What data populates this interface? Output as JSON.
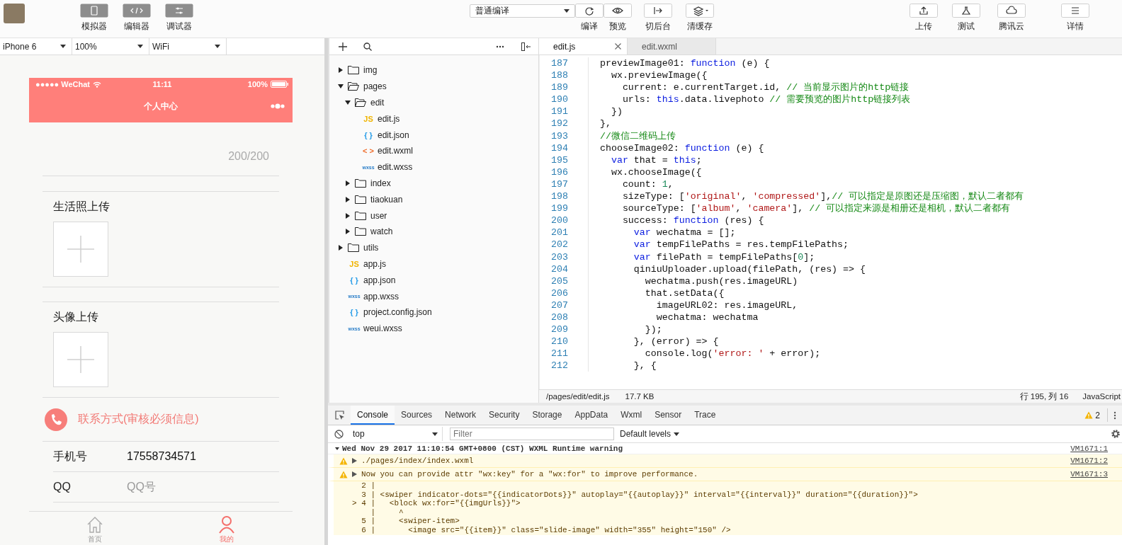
{
  "toolbar": {
    "left_buttons": [
      {
        "label": "模拟器",
        "kind": "phone"
      },
      {
        "label": "编辑器",
        "kind": "code"
      },
      {
        "label": "调试器",
        "kind": "debug"
      }
    ],
    "compile_select": {
      "value": "普通编译"
    },
    "center_buttons": [
      {
        "label": "编译",
        "kind": "refresh"
      },
      {
        "label": "预览",
        "kind": "eye"
      },
      {
        "label": "切后台",
        "kind": "switch"
      },
      {
        "label": "清缓存",
        "kind": "layers"
      }
    ],
    "right_buttons": [
      {
        "label": "上传",
        "kind": "upload"
      },
      {
        "label": "测试",
        "kind": "flask"
      },
      {
        "label": "腾讯云",
        "kind": "cloud"
      },
      {
        "label": "详情",
        "kind": "menu"
      }
    ]
  },
  "simulator": {
    "selects": [
      {
        "value": "iPhone 6"
      },
      {
        "value": "100%"
      },
      {
        "value": "WiFi"
      }
    ],
    "status_bar": {
      "carrier": "●●●●● WeChat",
      "time": "11:11",
      "battery": "100%"
    },
    "nav_title": "个人中心",
    "counter": "200/200",
    "uploads": [
      {
        "title": "生活照上传"
      },
      {
        "title": "头像上传"
      }
    ],
    "contact_heading": "联系方式(审核必须信息)",
    "fields": [
      {
        "label": "手机号",
        "value": "17558734571"
      },
      {
        "label": "QQ",
        "placeholder": "QQ号"
      }
    ],
    "tab_bar": [
      {
        "label": "首页",
        "kind": "home",
        "selected": false
      },
      {
        "label": "我的",
        "kind": "person",
        "selected": true
      }
    ]
  },
  "file_tree": {
    "items": [
      {
        "name": "img",
        "kind": "folder",
        "expanded": false
      },
      {
        "name": "pages",
        "kind": "folder",
        "expanded": true,
        "children": [
          {
            "name": "edit",
            "kind": "folder",
            "expanded": true,
            "children": [
              {
                "name": "edit.js",
                "kind": "js",
                "icon_text": "JS"
              },
              {
                "name": "edit.json",
                "kind": "json",
                "icon_text": "{ }"
              },
              {
                "name": "edit.wxml",
                "kind": "wxml",
                "icon_text": "< >"
              },
              {
                "name": "edit.wxss",
                "kind": "wxss",
                "icon_text": "wxss"
              }
            ]
          },
          {
            "name": "index",
            "kind": "folder",
            "expanded": false
          },
          {
            "name": "tiaokuan",
            "kind": "folder",
            "expanded": false
          },
          {
            "name": "user",
            "kind": "folder",
            "expanded": false
          },
          {
            "name": "watch",
            "kind": "folder",
            "expanded": false
          }
        ]
      },
      {
        "name": "utils",
        "kind": "folder",
        "expanded": false
      },
      {
        "name": "app.js",
        "kind": "js",
        "icon_text": "JS"
      },
      {
        "name": "app.json",
        "kind": "json",
        "icon_text": "{ }"
      },
      {
        "name": "app.wxss",
        "kind": "wxss",
        "icon_text": "wxss"
      },
      {
        "name": "project.config.json",
        "kind": "json",
        "icon_text": "{ }"
      },
      {
        "name": "weui.wxss",
        "kind": "wxss",
        "icon_text": "wxss"
      }
    ]
  },
  "editor": {
    "tabs": [
      {
        "label": "edit.js",
        "selected": true,
        "closable": true
      },
      {
        "label": "edit.wxml",
        "selected": false,
        "closable": false
      }
    ],
    "lines": [
      {
        "number": "187",
        "tokens": [
          {
            "kind": "plain",
            "text": "  previewImage01: "
          },
          {
            "kind": "keyword",
            "text": "function"
          },
          {
            "kind": "plain",
            "text": " (e) {"
          }
        ]
      },
      {
        "number": "188",
        "tokens": [
          {
            "kind": "plain",
            "text": "    wx.previewImage({"
          }
        ]
      },
      {
        "number": "189",
        "tokens": [
          {
            "kind": "plain",
            "text": "      current: e.currentTarget.id, "
          },
          {
            "kind": "comment",
            "text": "// 当前显示图片的http链接"
          }
        ]
      },
      {
        "number": "190",
        "tokens": [
          {
            "kind": "plain",
            "text": "      urls: "
          },
          {
            "kind": "keyword",
            "text": "this"
          },
          {
            "kind": "plain",
            "text": ".data.livephoto "
          },
          {
            "kind": "comment",
            "text": "// 需要预览的图片http链接列表"
          }
        ]
      },
      {
        "number": "191",
        "tokens": [
          {
            "kind": "plain",
            "text": "    })"
          }
        ]
      },
      {
        "number": "192",
        "tokens": [
          {
            "kind": "plain",
            "text": "  },"
          }
        ]
      },
      {
        "number": "193",
        "tokens": [
          {
            "kind": "comment",
            "text": "  //微信二维码上传"
          }
        ]
      },
      {
        "number": "194",
        "tokens": [
          {
            "kind": "plain",
            "text": "  chooseImage02: "
          },
          {
            "kind": "keyword",
            "text": "function"
          },
          {
            "kind": "plain",
            "text": " (e) {"
          }
        ]
      },
      {
        "number": "195",
        "tokens": [
          {
            "kind": "keyword",
            "text": "    var"
          },
          {
            "kind": "plain",
            "text": " that = "
          },
          {
            "kind": "keyword",
            "text": "this"
          },
          {
            "kind": "plain",
            "text": ";"
          }
        ]
      },
      {
        "number": "196",
        "tokens": [
          {
            "kind": "plain",
            "text": "    wx.chooseImage({"
          }
        ]
      },
      {
        "number": "197",
        "tokens": [
          {
            "kind": "plain",
            "text": "      count: "
          },
          {
            "kind": "number",
            "text": "1"
          },
          {
            "kind": "plain",
            "text": ","
          }
        ]
      },
      {
        "number": "198",
        "tokens": [
          {
            "kind": "plain",
            "text": "      sizeType: ["
          },
          {
            "kind": "string",
            "text": "'original'"
          },
          {
            "kind": "plain",
            "text": ", "
          },
          {
            "kind": "string",
            "text": "'compressed'"
          },
          {
            "kind": "plain",
            "text": "],"
          },
          {
            "kind": "comment",
            "text": "// 可以指定是原图还是压缩图，默认二者都有"
          }
        ]
      },
      {
        "number": "199",
        "tokens": [
          {
            "kind": "plain",
            "text": "      sourceType: ["
          },
          {
            "kind": "string",
            "text": "'album'"
          },
          {
            "kind": "plain",
            "text": ", "
          },
          {
            "kind": "string",
            "text": "'camera'"
          },
          {
            "kind": "plain",
            "text": "], "
          },
          {
            "kind": "comment",
            "text": "// 可以指定来源是相册还是相机，默认二者都有"
          }
        ]
      },
      {
        "number": "200",
        "tokens": [
          {
            "kind": "plain",
            "text": "      success: "
          },
          {
            "kind": "keyword",
            "text": "function"
          },
          {
            "kind": "plain",
            "text": " (res) {"
          }
        ]
      },
      {
        "number": "201",
        "tokens": [
          {
            "kind": "keyword",
            "text": "        var"
          },
          {
            "kind": "plain",
            "text": " wechatma = [];"
          }
        ]
      },
      {
        "number": "202",
        "tokens": [
          {
            "kind": "keyword",
            "text": "        var"
          },
          {
            "kind": "plain",
            "text": " tempFilePaths = res.tempFilePaths;"
          }
        ]
      },
      {
        "number": "203",
        "tokens": [
          {
            "kind": "keyword",
            "text": "        var"
          },
          {
            "kind": "plain",
            "text": " filePath = tempFilePaths["
          },
          {
            "kind": "number",
            "text": "0"
          },
          {
            "kind": "plain",
            "text": "];"
          }
        ]
      },
      {
        "number": "204",
        "tokens": [
          {
            "kind": "plain",
            "text": "        qiniuUploader.upload(filePath, (res) => {"
          }
        ]
      },
      {
        "number": "205",
        "tokens": [
          {
            "kind": "plain",
            "text": "          wechatma.push(res.imageURL)"
          }
        ]
      },
      {
        "number": "206",
        "tokens": [
          {
            "kind": "plain",
            "text": "          that.setData({"
          }
        ]
      },
      {
        "number": "207",
        "tokens": [
          {
            "kind": "plain",
            "text": "            imageURL02: res.imageURL,"
          }
        ]
      },
      {
        "number": "208",
        "tokens": [
          {
            "kind": "plain",
            "text": "            wechatma: wechatma"
          }
        ]
      },
      {
        "number": "209",
        "tokens": [
          {
            "kind": "plain",
            "text": "          });"
          }
        ]
      },
      {
        "number": "210",
        "tokens": [
          {
            "kind": "plain",
            "text": "        }, (error) => {"
          }
        ]
      },
      {
        "number": "211",
        "tokens": [
          {
            "kind": "plain",
            "text": "          console.log("
          },
          {
            "kind": "string",
            "text": "'error: '"
          },
          {
            "kind": "plain",
            "text": " + error);"
          }
        ]
      },
      {
        "number": "212",
        "tokens": [
          {
            "kind": "plain",
            "text": "        }, {"
          }
        ]
      }
    ],
    "status": {
      "path": "/pages/edit/edit.js",
      "size": "17.7 KB",
      "cursor": "行 195, 列 16",
      "language": "JavaScript"
    }
  },
  "devtools": {
    "tabs": [
      {
        "label": "Console",
        "selected": true
      },
      {
        "label": "Sources",
        "selected": false
      },
      {
        "label": "Network",
        "selected": false
      },
      {
        "label": "Security",
        "selected": false
      },
      {
        "label": "Storage",
        "selected": false
      },
      {
        "label": "AppData",
        "selected": false
      },
      {
        "label": "Wxml",
        "selected": false
      },
      {
        "label": "Sensor",
        "selected": false
      },
      {
        "label": "Trace",
        "selected": false
      }
    ],
    "warning_count": "2",
    "context": "top",
    "filter": {
      "placeholder": "Filter"
    },
    "levels": "Default levels",
    "console": [
      {
        "kind": "header",
        "text": "Wed Nov 29 2017 11:10:54 GMT+0800 (CST) WXML Runtime warning",
        "source": "VM1671:1"
      },
      {
        "kind": "warning",
        "text": "./pages/index/index.wxml",
        "source": "VM1671:2"
      },
      {
        "kind": "warning",
        "text": "Now you can provide attr \"wx:key\" for a \"wx:for\" to improve performance.",
        "source": "VM1671:3"
      },
      {
        "kind": "code",
        "text": "  2 |"
      },
      {
        "kind": "code",
        "text": "  3 | <swiper indicator-dots=\"{{indicatorDots}}\" autoplay=\"{{autoplay}}\" interval=\"{{interval}}\" duration=\"{{duration}}\">"
      },
      {
        "kind": "code",
        "text": "> 4 |   <block wx:for=\"{{imgUrls}}\">"
      },
      {
        "kind": "code",
        "text": "    |     ^"
      },
      {
        "kind": "code",
        "text": "  5 |     <swiper-item>"
      },
      {
        "kind": "code",
        "text": "  6 |       <image src=\"{{item}}\" class=\"slide-image\" width=\"355\" height=\"150\" />"
      }
    ]
  }
}
